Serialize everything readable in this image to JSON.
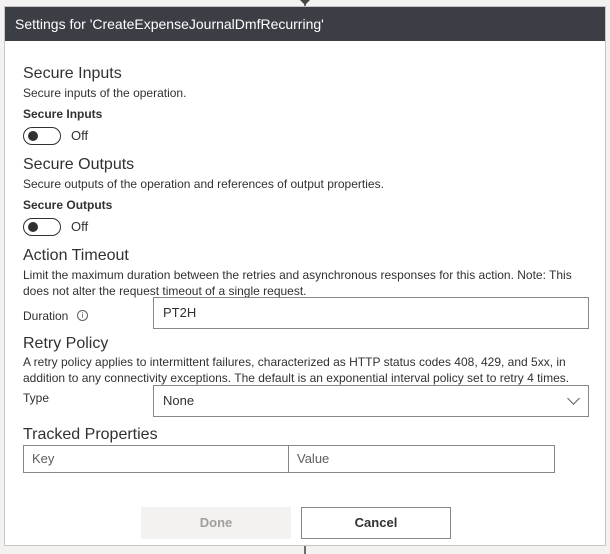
{
  "dialog": {
    "title": "Settings for 'CreateExpenseJournalDmfRecurring'"
  },
  "secure_inputs": {
    "title": "Secure Inputs",
    "description": "Secure inputs of the operation.",
    "toggle_label": "Secure Inputs",
    "toggle_state": "Off"
  },
  "secure_outputs": {
    "title": "Secure Outputs",
    "description": "Secure outputs of the operation and references of output properties.",
    "toggle_label": "Secure Outputs",
    "toggle_state": "Off"
  },
  "action_timeout": {
    "title": "Action Timeout",
    "description_line1": "Limit the maximum duration between the retries and asynchronous responses for this action. Note: This",
    "description_line2": "does not alter the request timeout of a single request.",
    "duration_label": "Duration",
    "info_icon": "i",
    "duration_value": "PT2H"
  },
  "retry_policy": {
    "title": "Retry Policy",
    "description_line1": "A retry policy applies to intermittent failures, characterized as HTTP status codes 408, 429, and 5xx, in",
    "description_line2": "addition to any connectivity exceptions. The default is an exponential interval policy set to retry 4 times.",
    "type_label": "Type",
    "type_value": "None"
  },
  "tracked_properties": {
    "title": "Tracked Properties",
    "key_placeholder": "Key",
    "value_placeholder": "Value"
  },
  "footer": {
    "done_label": "Done",
    "cancel_label": "Cancel"
  }
}
